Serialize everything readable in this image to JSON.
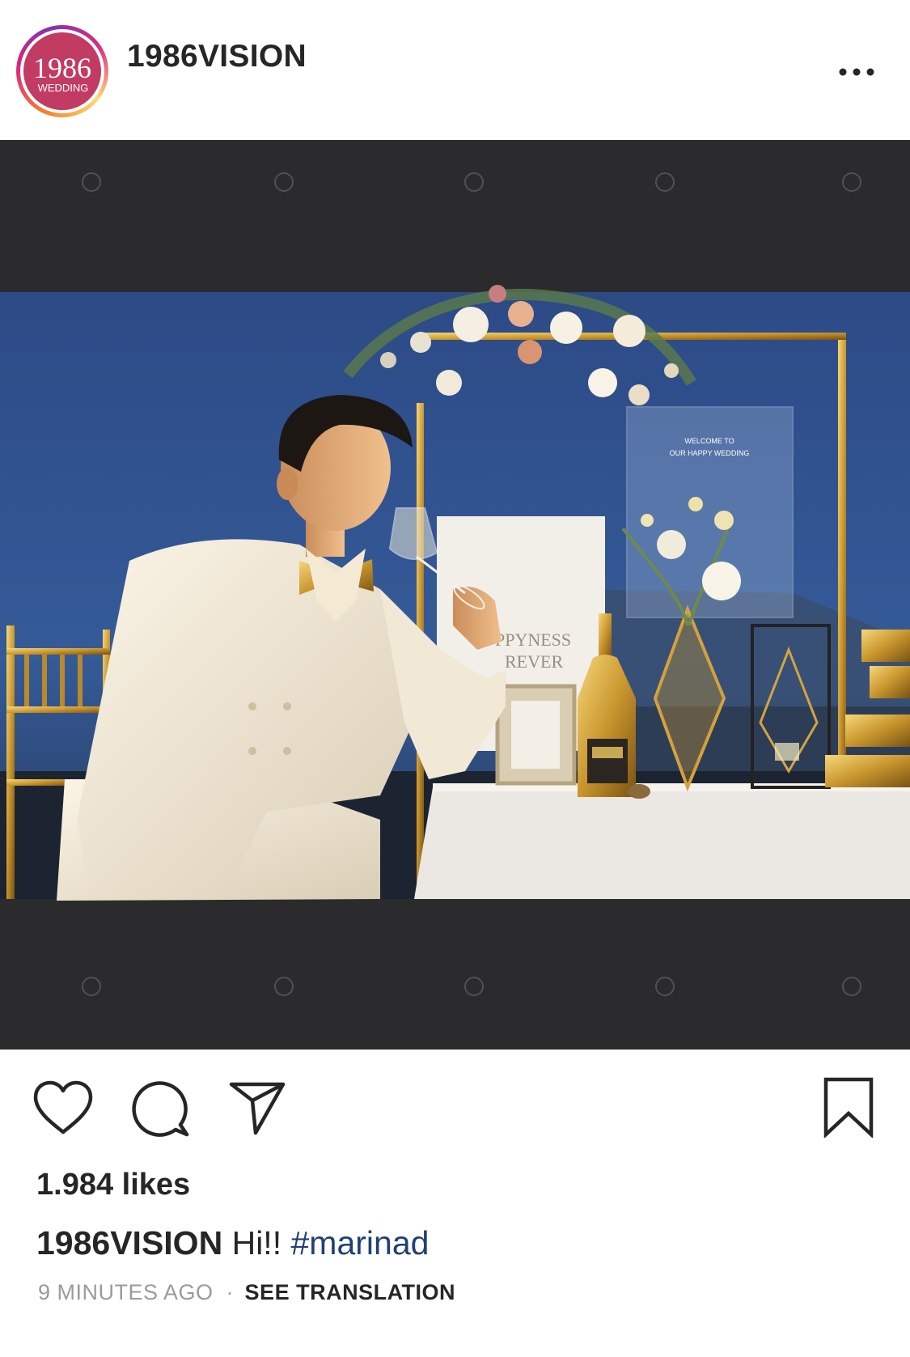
{
  "post": {
    "username": "1986VISION",
    "avatar_text_top": "1986",
    "avatar_text_bottom": "WEDDING",
    "photo_sign_line1": "WELCOME TO",
    "photo_sign_line2": "OUR HAPPY WEDDING",
    "photo_board_text1": "PPYNESS",
    "photo_board_text2": "REVER",
    "likes_text": "1.984 likes",
    "caption_user": "1986VISION",
    "caption_text": "Hi!!",
    "caption_hashtag": "#marinad",
    "time_text": "9 MINUTES AGO",
    "separator": "·",
    "translate_label": "SEE TRANSLATION"
  },
  "icons": {
    "more": "more-options-icon",
    "like": "heart-icon",
    "comment": "comment-icon",
    "share": "share-icon",
    "save": "bookmark-icon"
  },
  "colors": {
    "avatar_bg": "#c23b63",
    "hashtag": "#1f3f76",
    "secondary_text": "#9b9b9b",
    "photo_letterbox": "#2b2b2d",
    "sky": "#2e4c86"
  }
}
